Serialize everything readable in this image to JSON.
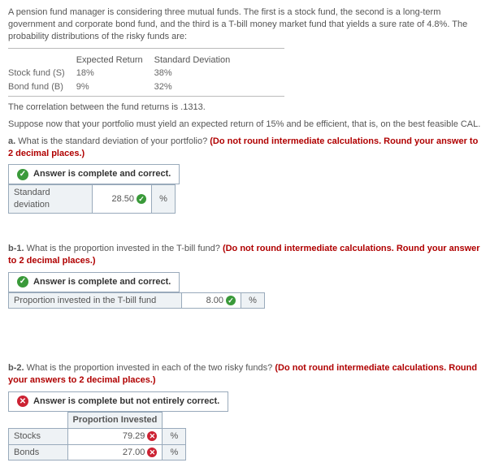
{
  "intro": "A pension fund manager is considering three mutual funds. The first is a stock fund, the second is a long-term government and corporate bond fund, and the third is a T-bill money market fund that yields a sure rate of 4.8%. The probability distributions of the risky funds are:",
  "given": {
    "headers": {
      "c1": "",
      "c2": "Expected Return",
      "c3": "Standard Deviation"
    },
    "rows": [
      {
        "label": "Stock fund (S)",
        "ret": "18%",
        "sd": "38%"
      },
      {
        "label": "Bond fund (B)",
        "ret": "9%",
        "sd": "32%"
      }
    ]
  },
  "corr": "The correlation between the fund returns is .1313.",
  "setup": "Suppose now that your portfolio must yield an expected return of 15% and be efficient, that is, on the best feasible CAL.",
  "a": {
    "q_prefix": "a.",
    "q_text": " What is the standard deviation of your portfolio? ",
    "hint": "(Do not round intermediate calculations. Round your answer to 2 decimal places.)",
    "banner": "Answer is complete and correct.",
    "row_label": "Standard deviation",
    "value": "28.50",
    "unit": "%"
  },
  "b1": {
    "q_prefix": "b-1.",
    "q_text": " What is the proportion invested in the T-bill fund? ",
    "hint": "(Do not round intermediate calculations. Round your answer to 2 decimal places.)",
    "banner": "Answer is complete and correct.",
    "row_label": "Proportion invested in the T-bill fund",
    "value": "8.00",
    "unit": "%"
  },
  "b2": {
    "q_prefix": "b-2.",
    "q_text": " What is the proportion invested in each of the two risky funds? ",
    "hint": "(Do not round intermediate calculations. Round your answers to 2 decimal places.)",
    "banner": "Answer is complete but not entirely correct.",
    "header": "Proportion Invested",
    "rows": [
      {
        "label": "Stocks",
        "value": "79.29",
        "unit": "%"
      },
      {
        "label": "Bonds",
        "value": "27.00",
        "unit": "%"
      }
    ]
  }
}
